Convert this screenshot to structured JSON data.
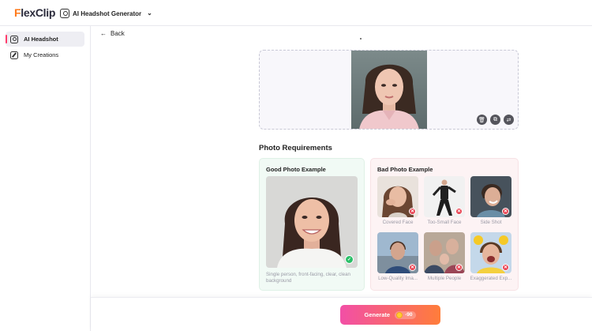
{
  "header": {
    "logo_prefix": "F",
    "logo_rest": "lexClip",
    "tool_name": "AI Headshot Generator"
  },
  "sidebar": {
    "items": [
      {
        "label": "AI Headshot",
        "icon": "face-frame-icon",
        "active": true
      },
      {
        "label": "My Creations",
        "icon": "edit-icon",
        "active": false
      }
    ]
  },
  "main": {
    "back_label": "Back",
    "requirements_title": "Photo Requirements",
    "good": {
      "title": "Good Photo Example",
      "description": "Single person, front-facing, clear, clean background"
    },
    "bad": {
      "title": "Bad Photo Example",
      "items": [
        {
          "label": "Covered Face"
        },
        {
          "label": "Too-Small Face"
        },
        {
          "label": "Side Shot"
        },
        {
          "label": "Low-Quality Ima..."
        },
        {
          "label": "Multiple People"
        },
        {
          "label": "Exaggerated Exp..."
        }
      ]
    }
  },
  "bottom": {
    "generate_label": "Generate",
    "credits": "-90"
  },
  "colors": {
    "accent_orange": "#ff7a1a",
    "active_indicator": "#ff3b6b",
    "generate_gradient_start": "#f24fa6",
    "generate_gradient_end": "#ff7d3a",
    "good_bg": "#f1faf5",
    "bad_bg": "#fdf3f4"
  }
}
